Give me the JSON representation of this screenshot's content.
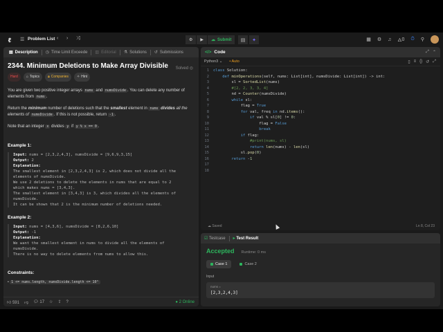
{
  "topbar": {
    "problem_list": "Problem List",
    "submit": "Submit",
    "streak": "0"
  },
  "left": {
    "tabs": [
      "Description",
      "Time Limit Exceede",
      "Editorial",
      "Solutions",
      "Submissions"
    ],
    "title": "2344. Minimum Deletions to Make Array Divisible",
    "solved": "Solved",
    "chips": [
      "Hard",
      "Topics",
      "Companies",
      "Hint"
    ],
    "p1": [
      "You are given two positive integer arrays ",
      "nums",
      " and ",
      "numsDivide",
      ". You can delete any number of elements from ",
      "nums",
      "."
    ],
    "p2": [
      "Return the ",
      "minimum",
      " number of deletions such that the ",
      "smallest",
      " element in ",
      "nums",
      " divides ",
      "all the elements",
      " of ",
      "numsDivide",
      ". If this is not possible, return ",
      "-1",
      "."
    ],
    "p3": [
      "Note that an integer ",
      "x",
      " divides ",
      "y",
      " if ",
      "y % x == 0",
      "."
    ],
    "ex1_title": "Example 1:",
    "ex1": [
      [
        "Input:",
        " nums = [2,3,2,4,3], numsDivide = [9,6,9,3,15]"
      ],
      [
        "Output:",
        " 2"
      ],
      [
        "Explanation:",
        ""
      ],
      [
        "",
        "The smallest element in [2,3,2,4,3] is 2, which does not divide all the"
      ],
      [
        "",
        "elements of numsDivide."
      ],
      [
        "",
        "We use 2 deletions to delete the elements in nums that are equal to 2"
      ],
      [
        "",
        "which makes nums = [3,4,3]."
      ],
      [
        "",
        "The smallest element in [3,4,3] is 3, which divides all the elements of"
      ],
      [
        "",
        "numsDivide."
      ],
      [
        "",
        "It can be shown that 2 is the minimum number of deletions needed."
      ]
    ],
    "ex2_title": "Example 2:",
    "ex2": [
      [
        "Input:",
        " nums = [4,3,6], numsDivide = [8,2,6,10]"
      ],
      [
        "Output:",
        " -1"
      ],
      [
        "Explanation:",
        ""
      ],
      [
        "",
        "We want the smallest element in nums to divide all the elements of"
      ],
      [
        "",
        "numsDivide."
      ],
      [
        "",
        "There is no way to delete elements from nums to allow this."
      ]
    ],
    "constraints_title": "Constraints:",
    "constraint1": "1 <= nums.length, numsDivide.length <= 10⁵",
    "likes": "591",
    "comments": "17",
    "online": "2 Online"
  },
  "code": {
    "tab": "Code",
    "language": "Python3",
    "auto": "Auto",
    "lines": [
      "class Solution:",
      "    def minOperations(self, nums: List[int], numsDivide: List[int]) -> int:",
      "        sl = SortedList(nums)",
      "        #[2, 2, 3, 3, 4]",
      "        nd = Counter(numsDivide)",
      "        while sl:",
      "            flag = True",
      "            for val, freq in nd.items():",
      "                if val % sl[0] != 0:",
      "                    flag = False",
      "                    break",
      "            if flag:",
      "                #print(nums, sl)",
      "                return len(nums) - len(sl)",
      "            sl.pop(0)",
      "        return -1",
      "",
      ""
    ],
    "saved": "Saved",
    "cursor": "Ln 8, Col 23"
  },
  "test": {
    "tabs": [
      "Testcase",
      "Test Result"
    ],
    "status": "Accepted",
    "runtime": "Runtime: 0 ms",
    "cases": [
      "Case 1",
      "Case 2"
    ],
    "input_label": "Input",
    "var_name": "nums =",
    "var_value": "[2,3,2,4,3]"
  }
}
